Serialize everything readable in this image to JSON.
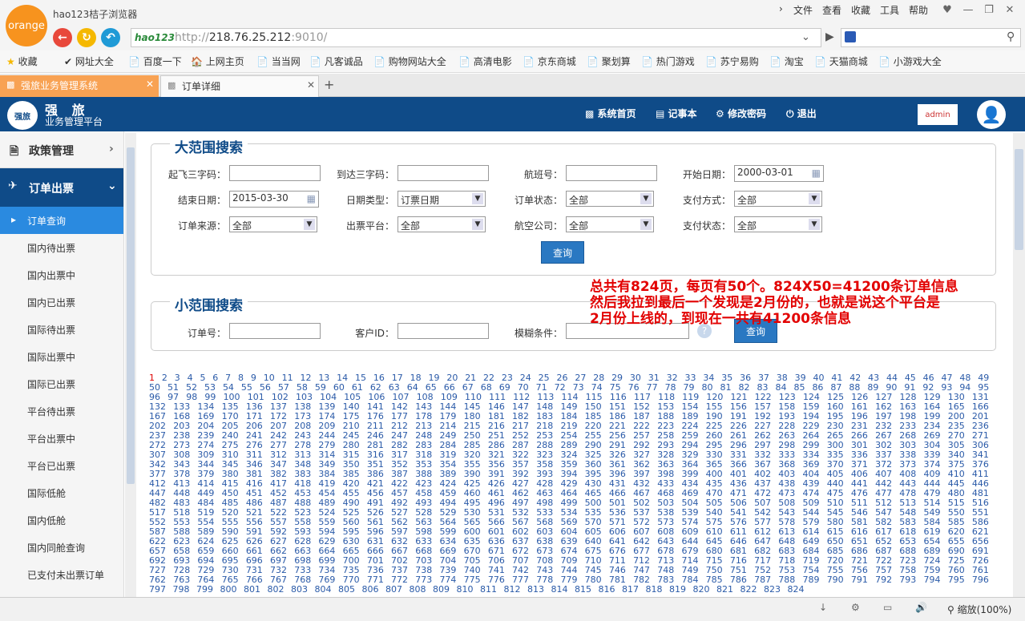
{
  "browser": {
    "name": "hao123桔子浏览器",
    "logo_text": "orange",
    "menus": [
      "文件",
      "查看",
      "收藏",
      "工具",
      "帮助"
    ],
    "address_brand": "hao123",
    "url_prefix": "http://",
    "url_host": "218.76.25.212",
    "url_suffix": ":9010/",
    "bookmarks": [
      "收藏",
      "网址大全",
      "百度一下",
      "上网主页",
      "当当网",
      "凡客诚品",
      "购物网站大全",
      "高清电影",
      "京东商城",
      "聚划算",
      "热门游戏",
      "苏宁易购",
      "淘宝",
      "天猫商城",
      "小游戏大全"
    ],
    "tabs": [
      {
        "label": "强旅业务管理系统",
        "active": true
      },
      {
        "label": "订单详细",
        "active": false
      }
    ],
    "zoom": "缩放(100%)"
  },
  "header": {
    "brand_title": "强 旅",
    "brand_subtitle": "业务管理平台",
    "brand_icon_text": "强旅",
    "nav": [
      "系统首页",
      "记事本",
      "修改密码",
      "退出"
    ],
    "user": "admin"
  },
  "sidebar": {
    "sections": [
      "政策管理",
      "订单出票"
    ],
    "items": [
      "订单查询",
      "国内待出票",
      "国内出票中",
      "国内已出票",
      "国际待出票",
      "国际出票中",
      "国际已出票",
      "平台待出票",
      "平台出票中",
      "平台已出票",
      "国际低舱",
      "国内低舱",
      "国内同舱查询",
      "已支付未出票订单"
    ]
  },
  "wide_search": {
    "title": "大范围搜索",
    "fields": {
      "dep_label": "起飞三字码：",
      "arr_label": "到达三字码：",
      "flight_label": "航班号：",
      "start_label": "开始日期：",
      "start_value": "2000-03-01",
      "end_label": "结束日期：",
      "end_value": "2015-03-30",
      "datetype_label": "日期类型：",
      "datetype_value": "订票日期",
      "status_label": "订单状态：",
      "status_value": "全部",
      "pay_label": "支付方式：",
      "pay_value": "全部",
      "source_label": "订单来源：",
      "source_value": "全部",
      "platform_label": "出票平台：",
      "platform_value": "全部",
      "airline_label": "航空公司：",
      "airline_value": "全部",
      "paystatus_label": "支付状态：",
      "paystatus_value": "全部"
    },
    "query_button": "查询"
  },
  "narrow_search": {
    "title": "小范围搜索",
    "order_label": "订单号：",
    "customer_label": "客户ID：",
    "fuzzy_label": "模糊条件：",
    "query_button": "查询"
  },
  "annotation": {
    "text": "总共有824页，每页有50个。824X50=41200条订单信息\n然后我拉到最后一个发现是2月份的，也就是说这个平台是\n2月份上线的，到现在一共有41200条信息"
  },
  "pagination": {
    "current": 1,
    "total": 824
  },
  "colors": {
    "header_bg": "#0f4b88",
    "active_side": "#2a8ae0",
    "annotation": "#e20000",
    "logo": "#f7931e"
  }
}
